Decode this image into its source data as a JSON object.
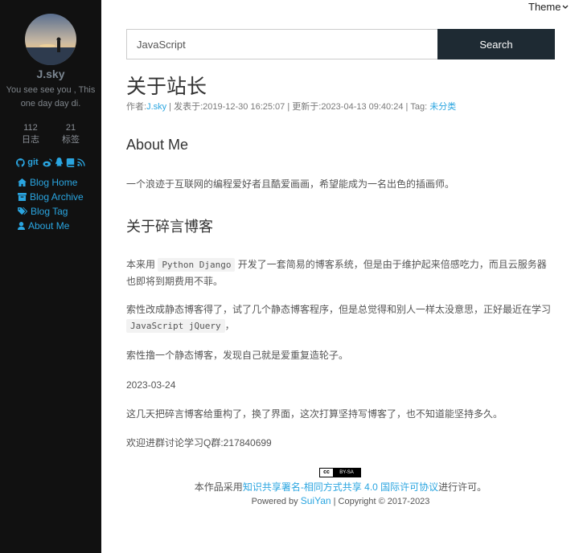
{
  "sidebar": {
    "author_name": "J.sky",
    "bio": "You see see you , This one day day di.",
    "stats": [
      {
        "num": "112",
        "label": "日志"
      },
      {
        "num": "21",
        "label": "标签"
      }
    ],
    "social": {
      "git_label": "git"
    },
    "nav": [
      {
        "label": "Blog Home",
        "icon": "home-icon"
      },
      {
        "label": "Blog Archive",
        "icon": "archive-icon"
      },
      {
        "label": "Blog Tag",
        "icon": "tags-icon"
      },
      {
        "label": "About Me",
        "icon": "user-icon"
      }
    ]
  },
  "header": {
    "theme_label": "Theme",
    "search_value": "JavaScript",
    "search_button": "Search"
  },
  "post": {
    "title": "关于站长",
    "meta": {
      "author_prefix": "作者:",
      "author": "J.sky",
      "published": " | 发表于:2019-12-30 16:25:07 | 更新于:2023-04-13 09:40:24 | Tag: ",
      "tag": "未分类"
    },
    "about_heading": "About Me",
    "about_text": "一个浪迹于互联网的编程爱好者且酷爱画画，希望能成为一名出色的插画师。",
    "blog_heading": "关于碎言博客",
    "p1_before": "本来用 ",
    "p1_code": "Python Django",
    "p1_after": " 开发了一套简易的博客系统，但是由于维护起来倍感吃力，而且云服务器也即将到期费用不菲。",
    "p2_before": "索性改成静态博客得了，试了几个静态博客程序，但是总觉得和别人一样太没意思，正好最近在学习 ",
    "p2_code": "JavaScript jQuery",
    "p2_after": "，",
    "p3": "索性撸一个静态博客，发现自己就是爱重复造轮子。",
    "date": "2023-03-24",
    "p4": "这几天把碎言博客给重构了，换了界面，这次打算坚持写博客了，也不知道能坚持多久。",
    "p5": "欢迎进群讨论学习Q群:217840699"
  },
  "footer": {
    "cc_left": "cc",
    "cc_right": "BY-SA",
    "license_prefix": "本作品采用",
    "license_link": "知识共享署名-相同方式共享 4.0 国际许可协议",
    "license_suffix": "进行许可。",
    "powered_prefix": "Powered by ",
    "powered_link": "SuiYan",
    "powered_suffix": " | Copyright © 2017-2023"
  },
  "colors": {
    "sidebar_bg": "#111111",
    "accent": "#2aa5e0",
    "search_button_bg": "#1e2a33"
  }
}
